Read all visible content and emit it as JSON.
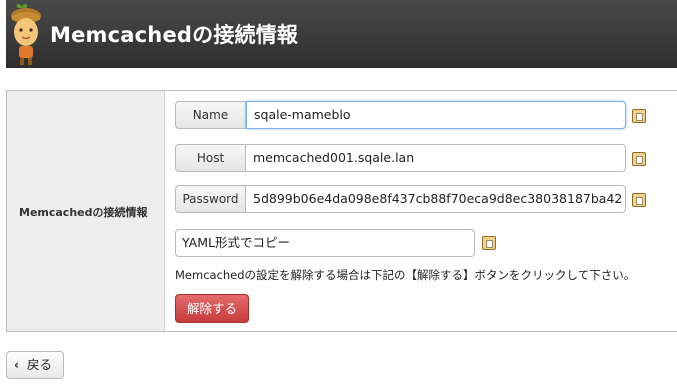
{
  "header": {
    "title": "Memcachedの接続情報",
    "mascot_icon": "acorn-mascot-icon"
  },
  "panel": {
    "label": "Memcachedの接続情報",
    "fields": [
      {
        "label": "Name",
        "value": "sqale-mameblo",
        "focused": true
      },
      {
        "label": "Host",
        "value": "memcached001.sqale.lan",
        "focused": false
      },
      {
        "label": "Password",
        "value": "5d899b06e4da098e8f437cb88f70eca9d8ec38038187ba42",
        "focused": false
      }
    ],
    "yaml_copy": "YAML形式でコピー",
    "note": "Memcachedの設定を解除する場合は下記の【解除する】ボタンをクリックして下さい。",
    "release_button": "解除する"
  },
  "footer": {
    "back_button": "戻る"
  },
  "colors": {
    "header_bg": "#333333",
    "danger": "#d04848",
    "focus": "#7fb2ea"
  }
}
